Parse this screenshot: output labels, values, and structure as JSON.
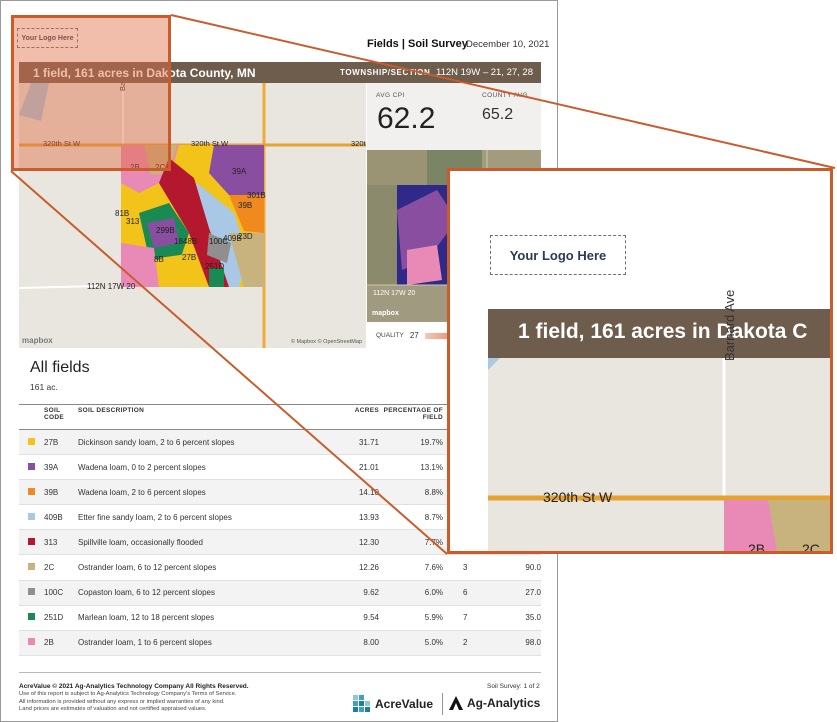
{
  "header": {
    "logo_placeholder": "Your Logo Here",
    "title": "Fields | Soil Survey",
    "date": "December 10, 2021"
  },
  "banner": {
    "title": "1 field, 161 acres in Dakota County, MN",
    "township_label": "TOWNSHIP/SECTION",
    "township_value": "112N 19W – 21, 27, 28"
  },
  "map": {
    "roads": [
      "Barnard Ave",
      "320th St W",
      "320th St W",
      "320th"
    ],
    "township_label": "112N 17W 20",
    "soil_labels": [
      "2B",
      "2C",
      "39A",
      "301B",
      "81B",
      "39B",
      "313",
      "299B",
      "409B",
      "23D",
      "1848B",
      "100C",
      "8B",
      "27B",
      "251D"
    ],
    "mapbox": "mapbox",
    "attribution": "© Mapbox © OpenStreetMap"
  },
  "stats": {
    "avg_cpi_label": "AVG CPI",
    "avg_cpi_value": "62.2",
    "county_avg_label": "COUNTY AVG",
    "county_avg_value": "65.2"
  },
  "satellite": {
    "label": "112N 17W 20",
    "mapbox": "mapbox"
  },
  "quality": {
    "label": "QUALITY",
    "value": "27"
  },
  "fields": {
    "title": "All fields",
    "acres": "161 ac."
  },
  "table": {
    "headers": {
      "code": "SOIL CODE",
      "description": "SOIL DESCRIPTION",
      "acres": "ACRES",
      "percentage": "PERCENTAGE OF FIELD"
    },
    "rows": [
      {
        "color": "#f2c318",
        "code": "27B",
        "description": "Dickinson sandy loam, 2 to 6 percent slopes",
        "acres": "31.71",
        "pct": "19.7%",
        "class": "",
        "cpi": ""
      },
      {
        "color": "#8a4ea0",
        "code": "39A",
        "description": "Wadena loam, 0 to 2 percent slopes",
        "acres": "21.01",
        "pct": "13.1%",
        "class": "",
        "cpi": ""
      },
      {
        "color": "#f08a1e",
        "code": "39B",
        "description": "Wadena loam, 2 to 6 percent slopes",
        "acres": "14.10",
        "pct": "8.8%",
        "class": "",
        "cpi": ""
      },
      {
        "color": "#a9c8e6",
        "code": "409B",
        "description": "Etter fine sandy loam, 2 to 6 percent slopes",
        "acres": "13.93",
        "pct": "8.7%",
        "class": "",
        "cpi": ""
      },
      {
        "color": "#b3182f",
        "code": "313",
        "description": "Spillville loam, occasionally flooded",
        "acres": "12.30",
        "pct": "7.7%",
        "class": "",
        "cpi": ""
      },
      {
        "color": "#c8b27e",
        "code": "2C",
        "description": "Ostrander loam, 6 to 12 percent slopes",
        "acres": "12.26",
        "pct": "7.6%",
        "class": "3",
        "cpi": "90.0"
      },
      {
        "color": "#8f8f8f",
        "code": "100C",
        "description": "Copaston loam, 6 to 12 percent slopes",
        "acres": "9.62",
        "pct": "6.0%",
        "class": "6",
        "cpi": "27.0"
      },
      {
        "color": "#1a8a55",
        "code": "251D",
        "description": "Marlean loam, 12 to 18 percent slopes",
        "acres": "9.54",
        "pct": "5.9%",
        "class": "7",
        "cpi": "35.0"
      },
      {
        "color": "#e88ab5",
        "code": "2B",
        "description": "Ostrander loam, 1 to 6 percent slopes",
        "acres": "8.00",
        "pct": "5.0%",
        "class": "2",
        "cpi": "98.0"
      }
    ]
  },
  "footer": {
    "copyright": "AcreValue © 2021 Ag-Analytics Technology Company All Rights Reserved.",
    "note1": "Use of this report is subject to Ag-Analytics Technology Company's Terms of Service.",
    "note2": "All information is provided without any express or implied warranties of any kind.",
    "note3": "Land prices are estimates of valuation and not certified appraised values.",
    "page": "Soil Survey: 1 of 2",
    "brand1": "AcreValue",
    "brand2": "Ag-Analytics"
  },
  "inset": {
    "logo_placeholder": "Your Logo Here",
    "banner_text": "1 field, 161 acres in Dakota C",
    "road_vertical": "Barnard Ave",
    "road_horizontal": "320th St W",
    "label_a": "2B",
    "label_b": "2C"
  }
}
